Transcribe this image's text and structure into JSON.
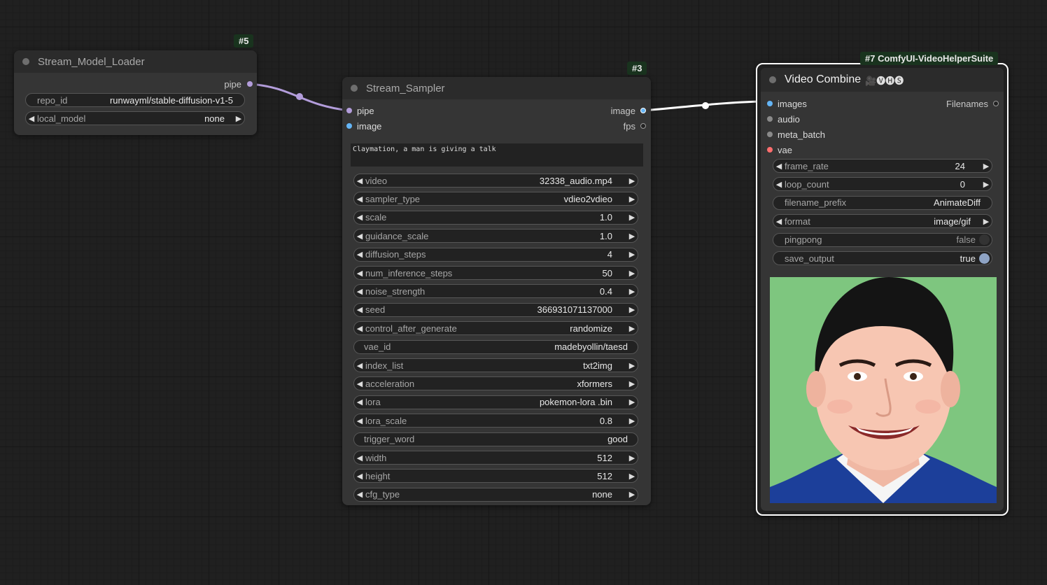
{
  "colors": {
    "pipe": "#b39ddb",
    "image": "#64b5f6",
    "vae": "#ff6e6e",
    "preview_bg": "#7ec67f"
  },
  "loader": {
    "badge": "#5",
    "title": "Stream_Model_Loader",
    "output_pipe": "pipe",
    "repo_id_label": "repo_id",
    "repo_id_value": "runwayml/stable-diffusion-v1-5",
    "local_model_label": "local_model",
    "local_model_value": "none"
  },
  "sampler": {
    "badge": "#3",
    "title": "Stream_Sampler",
    "input_pipe": "pipe",
    "input_image": "image",
    "output_image": "image",
    "output_fps": "fps",
    "prompt": "Claymation, a man is giving a talk",
    "widgets": [
      {
        "label": "video",
        "value": "32338_audio.mp4"
      },
      {
        "label": "sampler_type",
        "value": "vdieo2vdieo"
      },
      {
        "label": "scale",
        "value": "1.0"
      },
      {
        "label": "guidance_scale",
        "value": "1.0"
      },
      {
        "label": "diffusion_steps",
        "value": "4"
      },
      {
        "label": "num_inference_steps",
        "value": "50"
      },
      {
        "label": "noise_strength",
        "value": "0.4"
      },
      {
        "label": "seed",
        "value": "366931071137000"
      },
      {
        "label": "control_after_generate",
        "value": "randomize"
      },
      {
        "label": "vae_id",
        "value": "madebyollin/taesd"
      },
      {
        "label": "index_list",
        "value": "txt2img"
      },
      {
        "label": "acceleration",
        "value": "xformers"
      },
      {
        "label": "lora",
        "value": "pokemon-lora .bin"
      },
      {
        "label": "lora_scale",
        "value": "0.8"
      },
      {
        "label": "trigger_word",
        "value": "good"
      },
      {
        "label": "width",
        "value": "512"
      },
      {
        "label": "height",
        "value": "512"
      },
      {
        "label": "cfg_type",
        "value": "none"
      }
    ]
  },
  "combine": {
    "badge": "#7 ComfyUI-VideoHelperSuite",
    "title": "Video Combine",
    "title_icons": "🎥🅥🅗🅢",
    "inputs": [
      {
        "label": "images"
      },
      {
        "label": "audio"
      },
      {
        "label": "meta_batch"
      },
      {
        "label": "vae"
      }
    ],
    "output_filenames": "Filenames",
    "widgets": [
      {
        "label": "frame_rate",
        "value": "24"
      },
      {
        "label": "loop_count",
        "value": "0"
      },
      {
        "label": "filename_prefix",
        "value": "AnimateDiff"
      },
      {
        "label": "format",
        "value": "image/gif"
      },
      {
        "label": "pingpong",
        "value": "false"
      },
      {
        "label": "save_output",
        "value": "true"
      }
    ]
  }
}
